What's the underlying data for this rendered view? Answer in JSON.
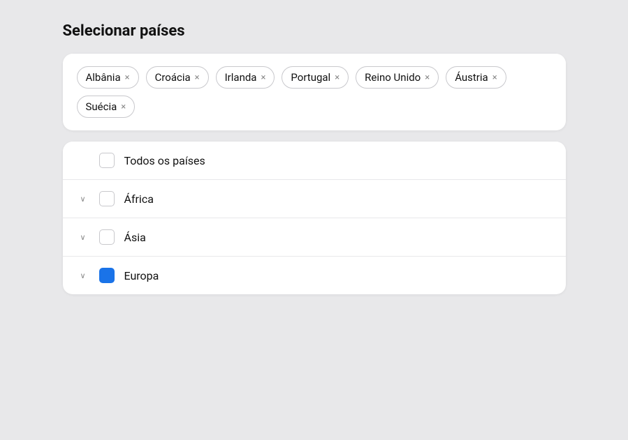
{
  "page": {
    "title": "Selecionar países"
  },
  "selected_tags": [
    {
      "id": "albania",
      "label": "Albânia"
    },
    {
      "id": "croatia",
      "label": "Croácia"
    },
    {
      "id": "ireland",
      "label": "Irlanda"
    },
    {
      "id": "portugal",
      "label": "Portugal"
    },
    {
      "id": "uk",
      "label": "Reino Unido"
    },
    {
      "id": "austria",
      "label": "Áustria"
    },
    {
      "id": "sweden",
      "label": "Suécia"
    }
  ],
  "list_items": [
    {
      "id": "all",
      "label": "Todos os países",
      "has_chevron": false,
      "checked": false,
      "filled": false
    },
    {
      "id": "africa",
      "label": "África",
      "has_chevron": true,
      "checked": false,
      "filled": false
    },
    {
      "id": "asia",
      "label": "Ásia",
      "has_chevron": true,
      "checked": false,
      "filled": false
    },
    {
      "id": "europe",
      "label": "Europa",
      "has_chevron": true,
      "checked": true,
      "filled": true
    }
  ],
  "icons": {
    "remove": "×",
    "chevron_down": "∨"
  }
}
